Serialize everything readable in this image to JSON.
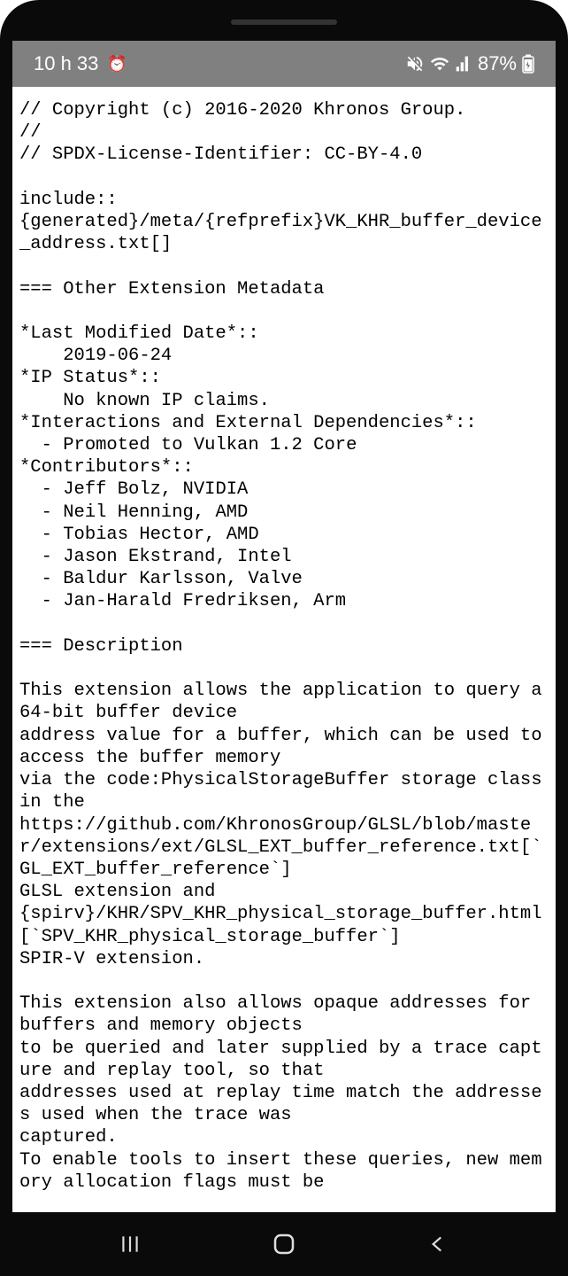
{
  "status_bar": {
    "time": "10 h 33",
    "battery_pct": "87%"
  },
  "document": {
    "copyright": "// Copyright (c) 2016-2020 Khronos Group.",
    "blank_comment": "//",
    "license": "// SPDX-License-Identifier: CC-BY-4.0",
    "include_kw": "include::",
    "include_path": "{generated}/meta/{refprefix}VK_KHR_buffer_device_address.txt[]",
    "section_metadata": "=== Other Extension Metadata",
    "last_modified_label": "*Last Modified Date*::",
    "last_modified_value": "    2019-06-24",
    "ip_status_label": "*IP Status*::",
    "ip_status_value": "    No known IP claims.",
    "interactions_label": "*Interactions and External Dependencies*::",
    "interactions_value": "  - Promoted to Vulkan 1.2 Core",
    "contributors_label": "*Contributors*::",
    "contributors": [
      "  - Jeff Bolz, NVIDIA",
      "  - Neil Henning, AMD",
      "  - Tobias Hector, AMD",
      "  - Jason Ekstrand, Intel",
      "  - Baldur Karlsson, Valve",
      "  - Jan-Harald Fredriksen, Arm"
    ],
    "section_description": "=== Description",
    "desc_p1_l1": "This extension allows the application to query a 64-bit buffer device",
    "desc_p1_l2": "address value for a buffer, which can be used to access the buffer memory",
    "desc_p1_l3": "via the code:PhysicalStorageBuffer storage class in the",
    "desc_p1_l4": "https://github.com/KhronosGroup/GLSL/blob/master/extensions/ext/GLSL_EXT_buffer_reference.txt[`GL_EXT_buffer_reference`]",
    "desc_p1_l5": "GLSL extension and",
    "desc_p1_l6": "{spirv}/KHR/SPV_KHR_physical_storage_buffer.html[`SPV_KHR_physical_storage_buffer`]",
    "desc_p1_l7": "SPIR-V extension.",
    "desc_p2_l1": "This extension also allows opaque addresses for buffers and memory objects",
    "desc_p2_l2": "to be queried and later supplied by a trace capture and replay tool, so that",
    "desc_p2_l3": "addresses used at replay time match the addresses used when the trace was",
    "desc_p2_l4": "captured.",
    "desc_p2_l5": "To enable tools to insert these queries, new memory allocation flags must be"
  }
}
